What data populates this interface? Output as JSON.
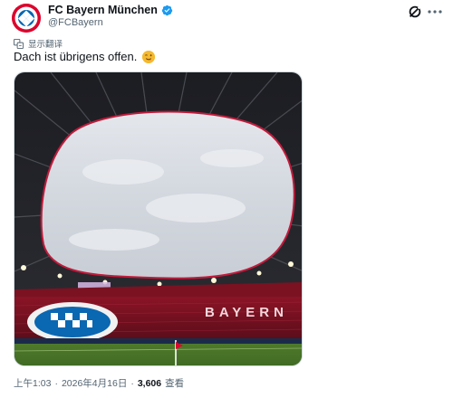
{
  "author": {
    "display_name": "FC Bayern München",
    "handle": "@FCBayern",
    "verified": true,
    "brand_color": "#dc052d"
  },
  "header_icons": {
    "grok": "grok-icon",
    "more": "more-icon"
  },
  "translate": {
    "label": "显示翻译",
    "icon": "translate-icon"
  },
  "tweet": {
    "text": "Dach ist übrigens offen.",
    "emoji": "winking-face-emoji"
  },
  "media": {
    "kind": "photo",
    "description_icon": "stadium-photo",
    "signage": "BAYERN"
  },
  "meta": {
    "time": "上午1:03",
    "dot1": "·",
    "date": "2026年4月16日",
    "dot2": "·",
    "views_count": "3,606",
    "views_label": "查看"
  }
}
